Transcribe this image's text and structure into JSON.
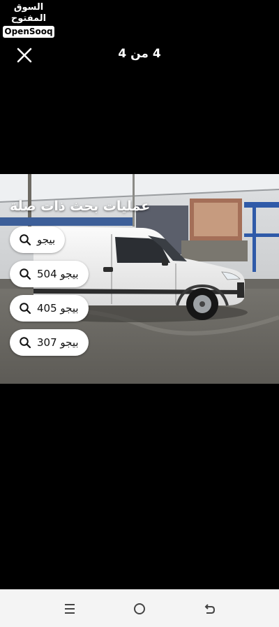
{
  "brand": {
    "name_ar": "السوق المفتوح",
    "name_en": "OpenSooq"
  },
  "header": {
    "close_icon": "close-icon",
    "image_counter": "4 من 4"
  },
  "photo": {
    "subject": "white-van-photo"
  },
  "related_searches": {
    "title": "عمليات بحث ذات صلة",
    "items": [
      {
        "label": "بيجو",
        "icon": "search-icon"
      },
      {
        "label": "بيجو 504",
        "icon": "search-icon"
      },
      {
        "label": "بيجو 405",
        "icon": "search-icon"
      },
      {
        "label": "بيجو 307",
        "icon": "search-icon"
      }
    ]
  },
  "system_nav": {
    "recents_icon": "recents-icon",
    "home_icon": "home-icon",
    "back_icon": "back-icon"
  }
}
